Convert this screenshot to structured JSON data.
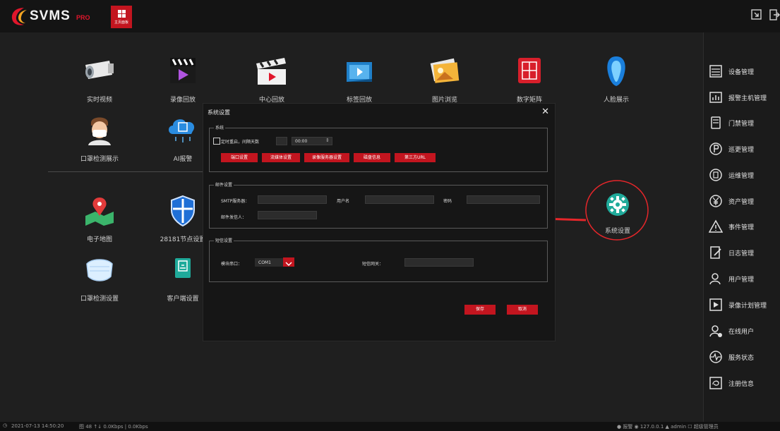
{
  "app": {
    "name": "SVMS",
    "edition": "PRO",
    "home_tab": "主页面板"
  },
  "tiles": [
    {
      "label": "实时视频",
      "icon": "camera-icon"
    },
    {
      "label": "录像回放",
      "icon": "video-playback-icon"
    },
    {
      "label": "中心回放",
      "icon": "clapperboard-icon"
    },
    {
      "label": "标签回放",
      "icon": "tag-playback-icon"
    },
    {
      "label": "图片浏览",
      "icon": "photos-icon"
    },
    {
      "label": "数字矩阵",
      "icon": "matrix-icon"
    },
    {
      "label": "人脸展示",
      "icon": "face-icon"
    },
    {
      "label": "口罩检测展示",
      "icon": "mask-person-icon"
    },
    {
      "label": "AI报警",
      "icon": "ai-cloud-icon"
    },
    {
      "label": "电子地图",
      "icon": "map-icon"
    },
    {
      "label": "28181节点设置",
      "icon": "shield-icon"
    },
    {
      "label": "系统设置",
      "icon": "gear-icon"
    },
    {
      "label": "口罩检测设置",
      "icon": "mask-icon"
    },
    {
      "label": "客户端设置",
      "icon": "client-icon"
    }
  ],
  "sidebar": [
    {
      "label": "设备管理",
      "icon": "device-icon"
    },
    {
      "label": "报警主机管理",
      "icon": "alarm-host-icon"
    },
    {
      "label": "门禁管理",
      "icon": "access-control-icon"
    },
    {
      "label": "巡更管理",
      "icon": "patrol-icon"
    },
    {
      "label": "运维管理",
      "icon": "maintenance-icon"
    },
    {
      "label": "资产管理",
      "icon": "asset-icon"
    },
    {
      "label": "事件管理",
      "icon": "warning-icon"
    },
    {
      "label": "日志管理",
      "icon": "log-icon"
    },
    {
      "label": "用户管理",
      "icon": "users-icon"
    },
    {
      "label": "录像计划管理",
      "icon": "record-plan-icon"
    },
    {
      "label": "在线用户",
      "icon": "online-user-icon"
    },
    {
      "label": "服务状态",
      "icon": "heartbeat-icon"
    },
    {
      "label": "注册信息",
      "icon": "register-icon"
    }
  ],
  "dialog": {
    "title": "系统设置",
    "system": {
      "legend": "系统",
      "restart_label": "定时重启，间隔天数",
      "time_value": "00:00",
      "buttons": [
        "端口设置",
        "流媒体设置",
        "录像服务器设置",
        "磁盘信息",
        "第三方URL"
      ]
    },
    "mail": {
      "legend": "邮件设置",
      "smtp_label": "SMTP服务器：",
      "user_label": "用户名",
      "password_label": "密码",
      "sender_label": "邮件发信人："
    },
    "sms": {
      "legend": "短信设置",
      "port_label": "模块串口：",
      "port_value": "COM1",
      "gateway_label": "短信网关："
    },
    "save": "保存",
    "cancel": "取消"
  },
  "statusbar": {
    "datetime": "2021-07-13 14:50:20",
    "left_text": "图 48  ↑↓ 0.0Kbps | 0.0Kbps",
    "right_text": "● 报警  ◉ 127.0.0.1  ▲ admin  ☐ 超级管理员"
  },
  "colors": {
    "accent": "#c3151f",
    "background": "#1e1e1e",
    "annotation": "#e5262a"
  }
}
